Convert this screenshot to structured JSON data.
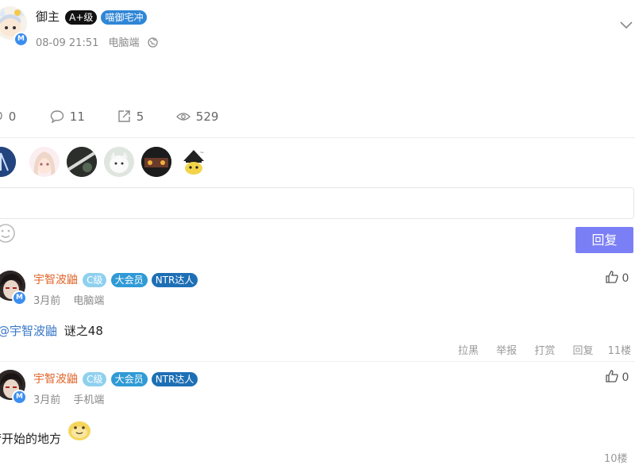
{
  "post": {
    "author": "御主",
    "level_badge": "A+级",
    "title_badge": "喵御宅冲",
    "avatar_badge": "M",
    "time": "08-09 21:51",
    "client": "电脑端",
    "stats": {
      "likes": "0",
      "comments": "11",
      "shares": "5",
      "views": "529"
    }
  },
  "reply_box": {
    "placeholder": "",
    "submit_label": "回复"
  },
  "comments": [
    {
      "author": "宇智波鼬",
      "badges": [
        "C级",
        "大会员",
        "NTR达人"
      ],
      "avatar_badge": "M",
      "time": "3月前",
      "client": "电脑端",
      "mention": "@宇智波鼬",
      "text": "谜之48",
      "likes": "0",
      "actions": [
        "拉黑",
        "举报",
        "打赏",
        "回复"
      ],
      "floor": "11楼"
    },
    {
      "author": "宇智波鼬",
      "badges": [
        "C级",
        "大会员",
        "NTR达人"
      ],
      "avatar_badge": "M",
      "time": "3月前",
      "client": "手机端",
      "text": "梦开始的地方",
      "likes": "0",
      "floor": "10楼"
    }
  ],
  "colors": {
    "accent": "#7b7ff5",
    "level_badge_bg": "#111111",
    "title_badge_bg": "#2f86d6",
    "c_level_bg": "#8fd0ef",
    "vip_bg": "#2f9ad6",
    "ntr_bg": "#1d6fb5",
    "username": "#e0662c",
    "mention": "#3a78c8"
  },
  "icons": [
    "chevron-down-icon",
    "globe-icon",
    "like-icon",
    "comment-icon",
    "share-icon",
    "view-icon",
    "emoji-icon",
    "thumbs-up-icon"
  ]
}
